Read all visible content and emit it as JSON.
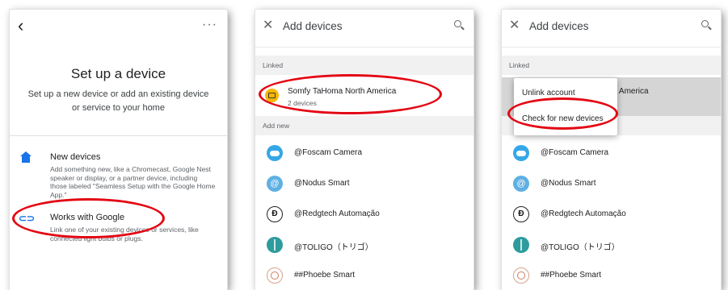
{
  "panel1": {
    "title": "Set up a device",
    "subtitle": "Set up a new device or add an existing device or service to your home",
    "options": [
      {
        "title": "New devices",
        "description": "Add something new, like a Chromecast, Google Nest speaker or display, or a partner device, including those labeled \"Seamless Setup with the Google Home App.\"",
        "icon": "home-icon"
      },
      {
        "title": "Works with Google",
        "description": "Link one of your existing devices or services, like connected light bulbs or plugs.",
        "icon": "link-icon"
      }
    ]
  },
  "header": {
    "title": "Add devices",
    "close_icon": "✕"
  },
  "sections": {
    "linked": "Linked",
    "add_new": "Add new"
  },
  "linked_service": {
    "name": "Somfy TaHoma North America",
    "subtitle": "2 devices"
  },
  "devices": [
    "@Foscam Camera",
    "@Nodus Smart",
    "@Redgtech Automação",
    "@TOLIGO（トリゴ）",
    "##Phoebe Smart"
  ],
  "panel3_menu": {
    "unlink": "Unlink account",
    "check": "Check for new devices",
    "truncated_name": "rth America"
  },
  "colors": {
    "accent_blue": "#1a73e8",
    "highlight_red": "#e30613"
  }
}
